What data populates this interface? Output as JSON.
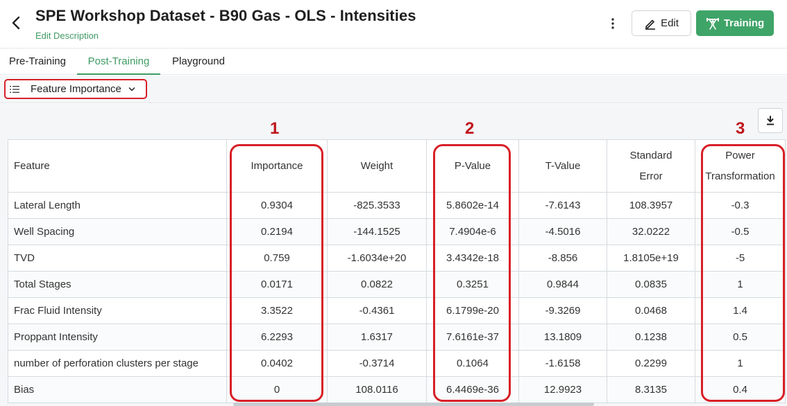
{
  "header": {
    "title": "SPE Workshop Dataset - B90 Gas - OLS - Intensities",
    "edit_description": "Edit Description",
    "edit_label": "Edit",
    "training_label": "Training",
    "accent_color": "#3fa468"
  },
  "tabs": [
    {
      "label": "Pre-Training",
      "active": false
    },
    {
      "label": "Post-Training",
      "active": true
    },
    {
      "label": "Playground",
      "active": false
    }
  ],
  "view_selector": {
    "label": "Feature Importance",
    "icon": "list-icon"
  },
  "markers": [
    "1",
    "2",
    "3"
  ],
  "table": {
    "headers": {
      "feature": "Feature",
      "importance": "Importance",
      "weight": "Weight",
      "pvalue": "P-Value",
      "tvalue": "T-Value",
      "stderr_line1": "Standard",
      "stderr_line2": "Error",
      "power_line1": "Power",
      "power_line2": "Transformation"
    },
    "rows": [
      {
        "feature": "Lateral Length",
        "importance": "0.9304",
        "weight": "-825.3533",
        "pvalue": "5.8602e-14",
        "tvalue": "-7.6143",
        "stderr": "108.3957",
        "power": "-0.3"
      },
      {
        "feature": "Well Spacing",
        "importance": "0.2194",
        "weight": "-144.1525",
        "pvalue": "7.4904e-6",
        "tvalue": "-4.5016",
        "stderr": "32.0222",
        "power": "-0.5"
      },
      {
        "feature": "TVD",
        "importance": "0.759",
        "weight": "-1.6034e+20",
        "pvalue": "3.4342e-18",
        "tvalue": "-8.856",
        "stderr": "1.8105e+19",
        "power": "-5"
      },
      {
        "feature": "Total Stages",
        "importance": "0.0171",
        "weight": "0.0822",
        "pvalue": "0.3251",
        "tvalue": "0.9844",
        "stderr": "0.0835",
        "power": "1"
      },
      {
        "feature": "Frac Fluid Intensity",
        "importance": "3.3522",
        "weight": "-0.4361",
        "pvalue": "6.1799e-20",
        "tvalue": "-9.3269",
        "stderr": "0.0468",
        "power": "1.4"
      },
      {
        "feature": "Proppant Intensity",
        "importance": "6.2293",
        "weight": "1.6317",
        "pvalue": "7.6161e-37",
        "tvalue": "13.1809",
        "stderr": "0.1238",
        "power": "0.5"
      },
      {
        "feature": "number of perforation clusters per stage",
        "importance": "0.0402",
        "weight": "-0.3714",
        "pvalue": "0.1064",
        "tvalue": "-1.6158",
        "stderr": "0.2299",
        "power": "1"
      },
      {
        "feature": "Bias",
        "importance": "0",
        "weight": "108.0116",
        "pvalue": "6.4469e-36",
        "tvalue": "12.9923",
        "stderr": "8.3135",
        "power": "0.4"
      }
    ]
  }
}
